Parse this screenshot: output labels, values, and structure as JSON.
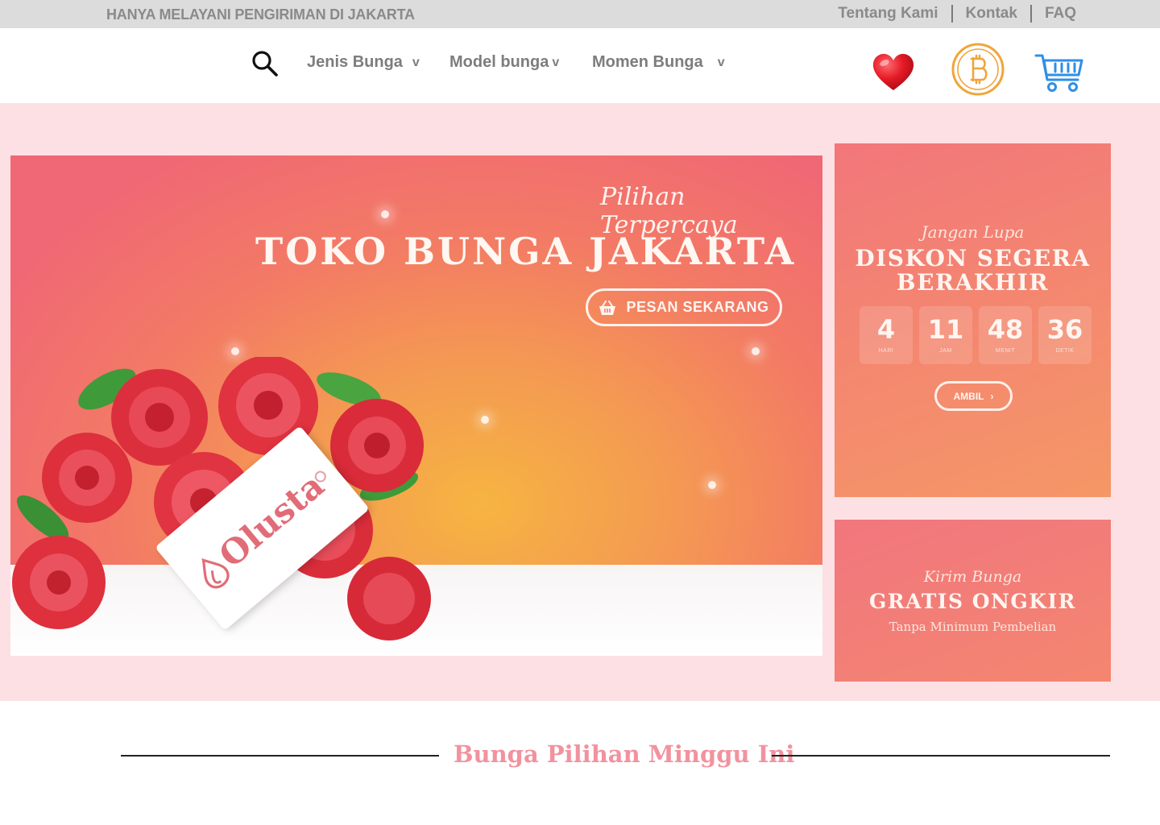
{
  "topbar": {
    "notice": "HANYA MELAYANI PENGIRIMAN DI JAKARTA",
    "links": [
      "Tentang Kami",
      "Kontak",
      "FAQ"
    ]
  },
  "nav": {
    "menu": [
      {
        "label": "Jenis Bunga",
        "chevron": "v"
      },
      {
        "label": "Model bunga",
        "chevron": "v"
      },
      {
        "label": "Momen Bunga",
        "chevron": "v"
      }
    ],
    "icons": [
      "search-icon",
      "heart-icon",
      "bitcoin-icon",
      "cart-icon"
    ]
  },
  "hero": {
    "script": "Pilihan Terpercaya",
    "title": "TOKO BUNGA JAKARTA",
    "button": "PESAN SEKARANG",
    "tag_brand": "Olusta"
  },
  "countdown": {
    "script": "Jangan Lupa",
    "title_line1": "DISKON SEGERA",
    "title_line2": "BERAKHIR",
    "timer": [
      {
        "value": "4",
        "unit": "HARI"
      },
      {
        "value": "11",
        "unit": "JAM"
      },
      {
        "value": "48",
        "unit": "MENIT"
      },
      {
        "value": "36",
        "unit": "DETIK"
      }
    ],
    "button": "AMBIL",
    "button_arrow": "›"
  },
  "shipping": {
    "script": "Kirim Bunga",
    "title": "GRATIS ONGKIR",
    "subtitle": "Tanpa Minimum Pembelian"
  },
  "section": {
    "title": "Bunga Pilihan Minggu  Ini"
  },
  "colors": {
    "topbar_bg": "#dcdcdc",
    "hero_bg": "#fde0e4",
    "accent_pink": "#f2929e",
    "heart_red": "#e0141f",
    "bitcoin_gold": "#f0a53a",
    "cart_blue": "#2f8fe6"
  }
}
